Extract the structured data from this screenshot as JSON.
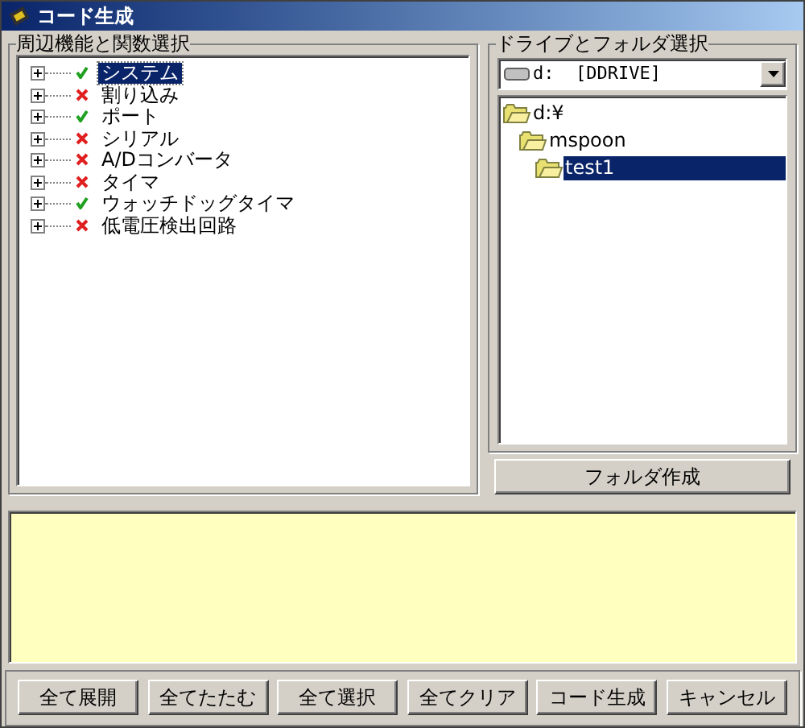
{
  "window": {
    "title": "コード生成"
  },
  "peripherals": {
    "label": "周辺機能と関数選択",
    "items": [
      {
        "label": "システム",
        "checked": true,
        "selected": true
      },
      {
        "label": "割り込み",
        "checked": false,
        "selected": false
      },
      {
        "label": "ポート",
        "checked": true,
        "selected": false
      },
      {
        "label": "シリアル",
        "checked": false,
        "selected": false
      },
      {
        "label": "A/Dコンバータ",
        "checked": false,
        "selected": false
      },
      {
        "label": "タイマ",
        "checked": false,
        "selected": false
      },
      {
        "label": "ウォッチドッグタイマ",
        "checked": true,
        "selected": false
      },
      {
        "label": "低電圧検出回路",
        "checked": false,
        "selected": false
      }
    ]
  },
  "folders": {
    "label": "ドライブとフォルダ選択",
    "drive": "d:  [DDRIVE]",
    "tree": [
      {
        "label": "d:¥",
        "selected": false,
        "children": [
          {
            "label": "mspoon",
            "selected": false,
            "children": [
              {
                "label": "test1",
                "selected": true
              }
            ]
          }
        ]
      }
    ],
    "button": "フォルダ作成"
  },
  "buttons": [
    "全て展開",
    "全てたたむ",
    "全て選択",
    "全てクリア",
    "コード生成",
    "キャンセル"
  ]
}
